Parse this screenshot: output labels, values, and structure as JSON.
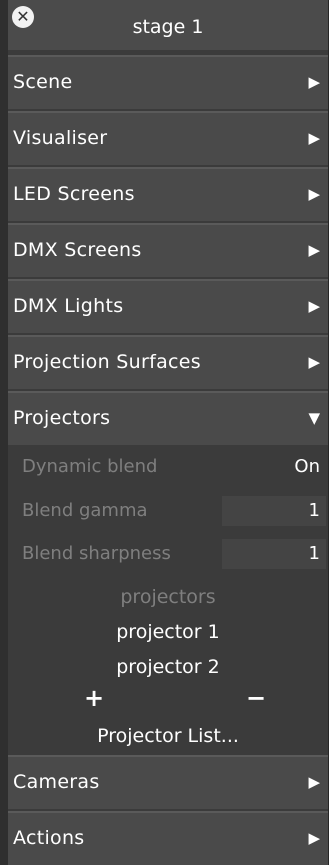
{
  "window": {
    "title": "stage 1",
    "close_icon": "close-icon"
  },
  "sections": [
    {
      "label": "Scene",
      "expanded": false
    },
    {
      "label": "Visualiser",
      "expanded": false
    },
    {
      "label": "LED Screens",
      "expanded": false
    },
    {
      "label": "DMX Screens",
      "expanded": false
    },
    {
      "label": "DMX Lights",
      "expanded": false
    },
    {
      "label": "Projection Surfaces",
      "expanded": false
    },
    {
      "label": "Projectors",
      "expanded": true
    },
    {
      "label": "Cameras",
      "expanded": false
    },
    {
      "label": "Actions",
      "expanded": false
    }
  ],
  "projectors": {
    "dynamic_blend": {
      "label": "Dynamic blend",
      "value": "On"
    },
    "blend_gamma": {
      "label": "Blend gamma",
      "value": "1"
    },
    "blend_sharpness": {
      "label": "Blend sharpness",
      "value": "1"
    },
    "list_header": "projectors",
    "items": [
      "projector 1",
      "projector 2"
    ],
    "add_label": "+",
    "remove_label": "−",
    "list_button": "Projector List..."
  },
  "icons": {
    "collapsed": "▶",
    "expanded": "▼"
  }
}
